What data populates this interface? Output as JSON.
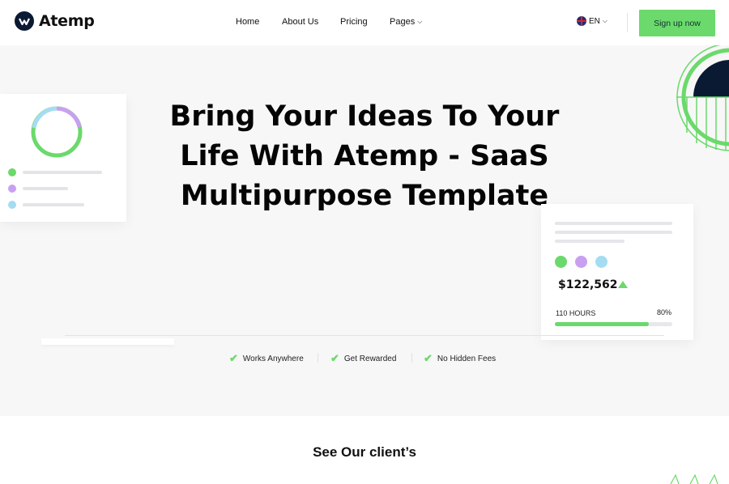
{
  "header": {
    "logo_text": "Atemp",
    "nav": {
      "home": "Home",
      "about": "About Us",
      "pricing": "Pricing",
      "pages": "Pages"
    },
    "language": "EN",
    "signup_label": "Sign up now"
  },
  "hero": {
    "title": "Bring Your Ideas To Your Life With Atemp - SaaS Multipurpose Template",
    "stats_card": {
      "amount": "$122,562",
      "hours_label": "110 HOURS",
      "percent_label": "80%",
      "progress": 0.8
    },
    "features": [
      "Works Anywhere",
      "Get Rewarded",
      "No Hidden Fees"
    ]
  },
  "clients": {
    "title": "See Our client’s"
  },
  "colors": {
    "accent_green": "#6bd96b",
    "purple": "#c9a0f0",
    "light_blue": "#a6dcf2",
    "navy": "#0b1a33"
  }
}
